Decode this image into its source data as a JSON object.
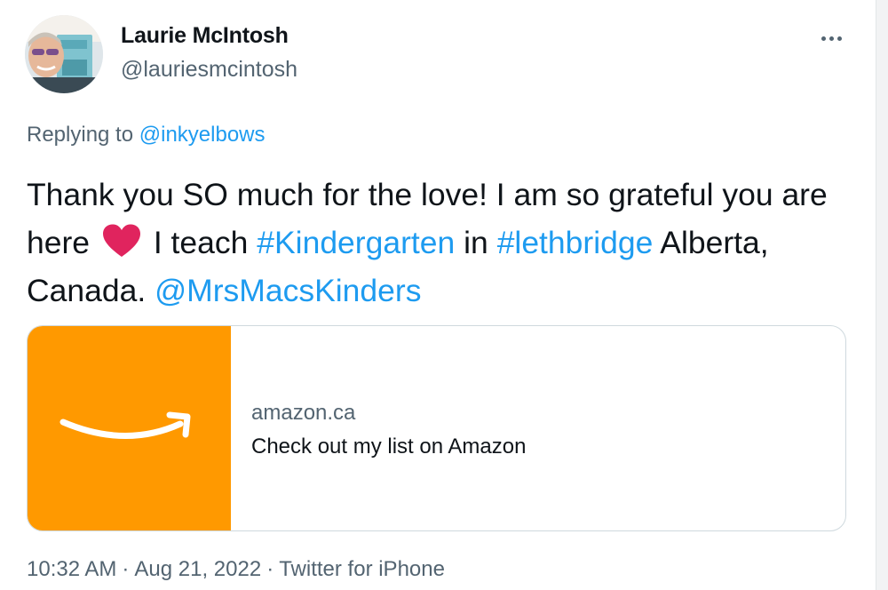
{
  "author": {
    "name": "Laurie McIntosh",
    "handle": "@lauriesmcintosh"
  },
  "reply": {
    "prefix": "Replying to",
    "to": "@inkyelbows"
  },
  "tweet": {
    "part1": "Thank you SO much for the love! I am so grateful you are here",
    "emoji": "heart-icon",
    "part2": "I teach",
    "hashtag1": "#Kindergarten",
    "part3": "in",
    "hashtag2": "#lethbridge",
    "part4": "Alberta, Canada.",
    "mention": "@MrsMacsKinders"
  },
  "card": {
    "domain": "amazon.ca",
    "title": "Check out my list on Amazon",
    "image_color": "#ff9900"
  },
  "meta": {
    "time": "10:32 AM",
    "date": "Aug 21, 2022",
    "source": "Twitter for iPhone",
    "separator": "·"
  },
  "colors": {
    "link": "#1d9bf0",
    "secondary_text": "#536471",
    "primary_text": "#0f1419",
    "heart": "#e0245e"
  },
  "icons": {
    "more": "more-dots-icon"
  }
}
